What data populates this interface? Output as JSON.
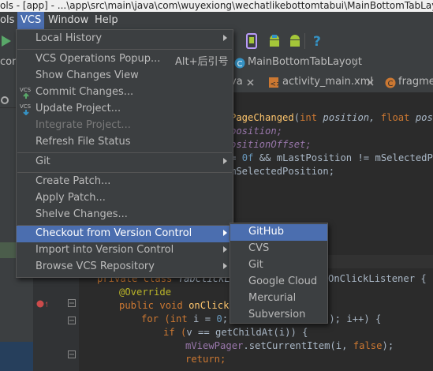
{
  "window": {
    "title": "ols - [app] - ...\\app\\src\\main\\java\\com\\wuyexiong\\wechatlikebottomtabui\\MainBottomTabLayout.java"
  },
  "menubar": {
    "items": [
      "ols",
      "VCS",
      "Window",
      "Help"
    ]
  },
  "navbar": {
    "breadcrumb": "MainBottomTabLayout",
    "left_stub": "com"
  },
  "tabs": [
    "va",
    "activity_main.xml",
    "fragmen"
  ],
  "vcs_menu": {
    "items": [
      {
        "label": "Local History",
        "submenu": true,
        "enabled": true
      },
      {
        "label": "VCS Operations Popup...",
        "shortcut": "Alt+后引号",
        "enabled": true
      },
      {
        "label": "Show Changes View",
        "enabled": true
      },
      {
        "label": "Commit Changes...",
        "enabled": true,
        "icon": "vcs-commit-icon"
      },
      {
        "label": "Update Project...",
        "enabled": true,
        "icon": "vcs-update-icon"
      },
      {
        "label": "Integrate Project...",
        "enabled": false
      },
      {
        "label": "Refresh File Status",
        "enabled": true
      },
      {
        "label": "Git",
        "submenu": true,
        "enabled": true
      },
      {
        "label": "Create Patch...",
        "enabled": true
      },
      {
        "label": "Apply Patch...",
        "enabled": true
      },
      {
        "label": "Shelve Changes...",
        "enabled": true
      },
      {
        "label": "Checkout from Version Control",
        "submenu": true,
        "enabled": true,
        "highlighted": true
      },
      {
        "label": "Import into Version Control",
        "submenu": true,
        "enabled": true
      },
      {
        "label": "Browse VCS Repository",
        "submenu": true,
        "enabled": true
      }
    ]
  },
  "checkout_submenu": {
    "items": [
      "GitHub",
      "CVS",
      "Git",
      "Google Cloud",
      "Mercurial",
      "Subversion"
    ],
    "highlighted": "GitHub"
  },
  "code": {
    "lines": [
      [
        "PageChanged",
        "(",
        "int",
        " position, ",
        "float",
        " posit"
      ],
      [
        "position;"
      ],
      [
        "ositionOffset;"
      ],
      [
        "= ",
        "0f",
        " && ",
        "mLastPosition",
        " != ",
        "mSelectedPos"
      ],
      [
        "mSelectedPosition;"
      ],
      [
        "private class ",
        "TabClickLi",
        "OnClickListener {"
      ],
      [
        "@Override"
      ],
      [
        "public void ",
        "onClick",
        "("
      ],
      [
        "for (",
        "int",
        " i = ",
        "0",
        "; ",
        "(); ",
        "i++) {"
      ],
      [
        "if (",
        "v",
        " == getChildAt(i)) {"
      ],
      [
        "mViewPager",
        ".setCurrentItem(i, ",
        "false",
        ");"
      ],
      [
        "return;"
      ]
    ]
  },
  "colors": {
    "accent": "#4b6eaf",
    "menu_bg": "#3c3f41",
    "editor_bg": "#2b2b2b"
  }
}
